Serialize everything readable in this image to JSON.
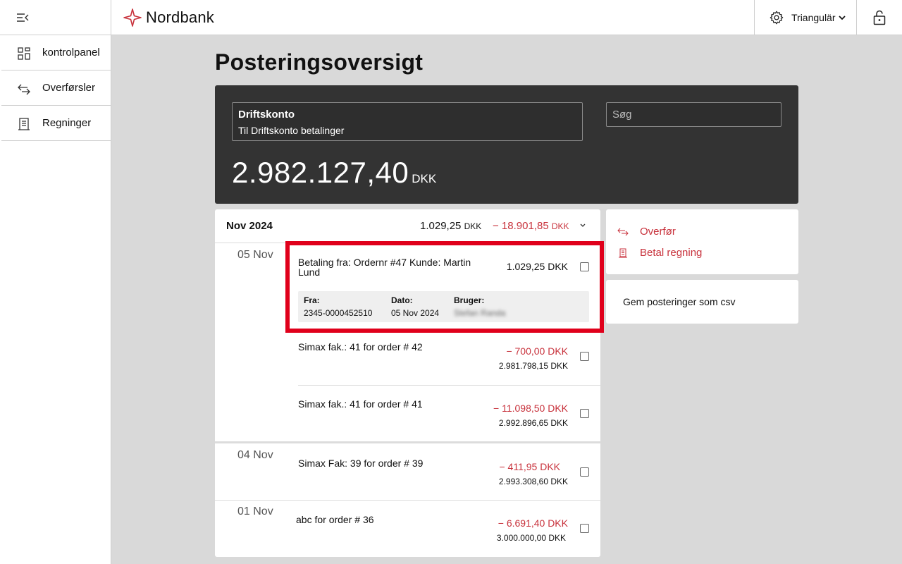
{
  "brand": {
    "name": "Nordbank",
    "accent": "#c8323c"
  },
  "header": {
    "user_name": "Triangulär"
  },
  "sidebar": {
    "items": [
      {
        "label": "kontrolpanel",
        "icon": "dashboard-icon"
      },
      {
        "label": "Overførsler",
        "icon": "transfer-icon"
      },
      {
        "label": "Regninger",
        "icon": "bill-icon"
      }
    ]
  },
  "page": {
    "title": "Posteringsoversigt"
  },
  "account": {
    "name": "Driftskonto",
    "description": "Til Driftskonto betalinger",
    "balance": "2.982.127,40",
    "currency": "DKK",
    "search_placeholder": "Søg"
  },
  "month": {
    "label": "Nov 2024",
    "in_amount": "1.029,25",
    "out_amount": "− 18.901,85",
    "currency": "DKK"
  },
  "days": [
    {
      "label": "05 Nov",
      "transactions": [
        {
          "description": "Betaling fra: Ordernr #47 Kunde: Martin Lund",
          "amount": "1.029,25 DKK",
          "details": {
            "from_label": "Fra:",
            "from_value": "2345-0000452510",
            "date_label": "Dato:",
            "date_value": "05 Nov 2024",
            "user_label": "Bruger:",
            "user_value": "Stefan Randa"
          }
        },
        {
          "description": "Simax fak.: 41 for order # 42",
          "amount": "− 700,00 DKK",
          "balance": "2.981.798,15 DKK"
        },
        {
          "description": "Simax fak.: 41 for order # 41",
          "amount": "− 11.098,50 DKK",
          "balance": "2.992.896,65 DKK"
        }
      ]
    },
    {
      "label": "04 Nov",
      "transactions": [
        {
          "description": "Simax Fak: 39 for order # 39",
          "amount": "− 411,95 DKK",
          "balance": "2.993.308,60 DKK"
        }
      ]
    },
    {
      "label": "01 Nov",
      "transactions": [
        {
          "description": "abc for order # 36",
          "amount": "− 6.691,40 DKK",
          "balance": "3.000.000,00 DKK"
        }
      ]
    }
  ],
  "actions": {
    "transfer_label": "Overfør",
    "pay_bill_label": "Betal regning",
    "csv_label": "Gem posteringer som csv"
  }
}
